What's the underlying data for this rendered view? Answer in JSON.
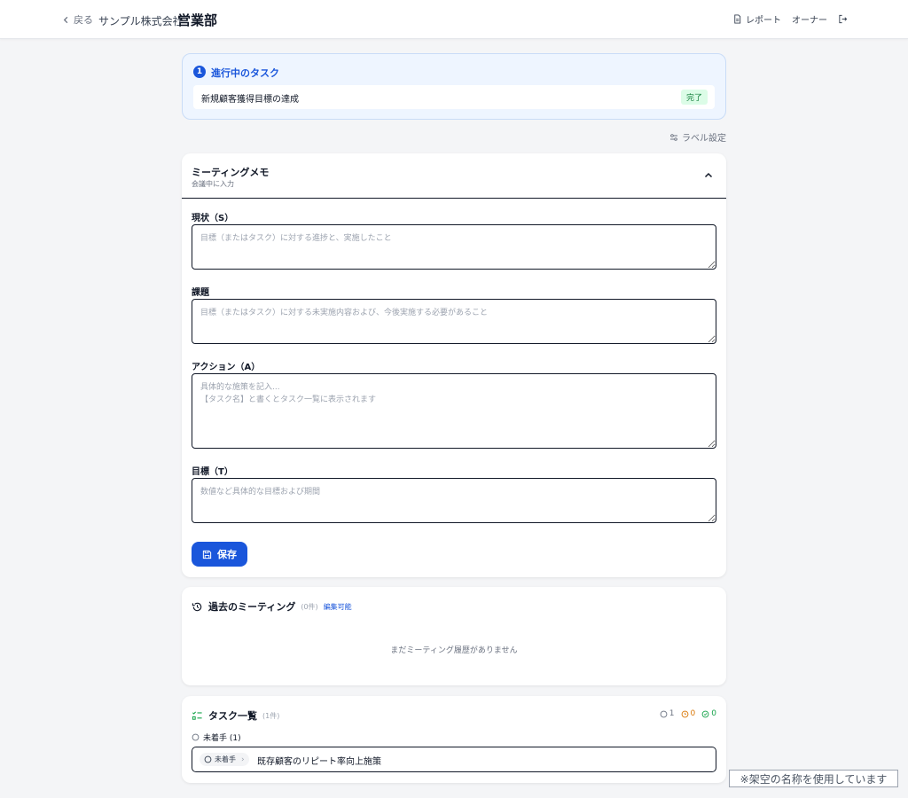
{
  "header": {
    "back_label": "戻る",
    "company": "サンプル株式会社",
    "department": "営業部",
    "report_label": "レポート",
    "owner_label": "オーナー"
  },
  "current_task": {
    "number": "1",
    "title": "進行中のタスク",
    "task_name": "新規顧客獲得目標の達成",
    "status": "完了"
  },
  "label_setting": "ラベル設定",
  "meeting_memo": {
    "title": "ミーティングメモ",
    "subtitle": "会議中に入力",
    "fields": [
      {
        "label": "現状（S）",
        "value": "",
        "placeholder": "目標（またはタスク）に対する進捗と、実施したこと"
      },
      {
        "label": "課題",
        "value": "",
        "placeholder": "目標（またはタスク）に対する未実施内容および、今後実施する必要があること"
      },
      {
        "label": "アクション（A）",
        "value": "",
        "placeholder": "具体的な施策を記入...\n【タスク名】と書くとタスク一覧に表示されます"
      },
      {
        "label": "目標（T）",
        "value": "",
        "placeholder": "数値など具体的な目標および期間"
      }
    ],
    "save_label": "保存"
  },
  "past_meetings": {
    "title": "過去のミーティング",
    "count": "(0件)",
    "edit_label": "編集可能",
    "empty_message": "まだミーティング履歴がありません"
  },
  "task_list": {
    "title": "タスク一覧",
    "count": "(1件)",
    "stats": {
      "not_started": "1",
      "in_progress": "0",
      "done": "0"
    },
    "stat_colors": {
      "not_started": "#6b7280",
      "in_progress": "#d97706",
      "done": "#16a34a"
    },
    "group_label": "未着手 (1)",
    "tasks": [
      {
        "status": "未着手",
        "name": "既存顧客のリピート率向上施策"
      }
    ]
  },
  "notice": "※架空の名称を使用しています",
  "colors": {
    "accent": "#1a56db",
    "done_bg": "#dcfce7",
    "done_text": "#15803d"
  }
}
